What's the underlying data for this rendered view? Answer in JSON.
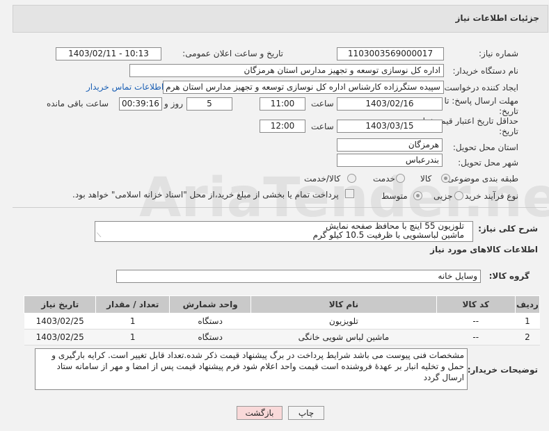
{
  "header": {
    "title": "جزئیات اطلاعات نیاز"
  },
  "watermark": "AriaTender.net",
  "fields": {
    "need_number_label": "شماره نیاز:",
    "need_number": "1103003569000017",
    "announce_label": "تاریخ و ساعت اعلان عمومی:",
    "announce_value": "1403/02/11 - 10:13",
    "buyer_label": "نام دستگاه خریدار:",
    "buyer_value": "اداره کل نوسازی  توسعه و تجهیز مدارس استان هرمزگان",
    "creator_label": "ایجاد کننده درخواست:",
    "creator_value": "سپیده ستگرزاده کارشناس اداره کل نوسازی  توسعه و تجهیز مدارس استان هرم",
    "contact_link": "اطلاعات تماس خریدار",
    "deadline_label_1": "مهلت ارسال پاسخ: تا",
    "deadline_label_2": "تاریخ:",
    "deadline_date": "1403/02/16",
    "time_label": "ساعت",
    "deadline_time": "11:00",
    "days_value": "5",
    "days_label": "روز و",
    "remaining_value": "00:39:16",
    "remaining_label": "ساعت باقی مانده",
    "validity_label_1": "حداقل تاریخ اعتبار قیمت: تا",
    "validity_label_2": "تاریخ:",
    "validity_date": "1403/03/15",
    "validity_time": "12:00",
    "province_label": "استان محل تحویل:",
    "province_value": "هرمزگان",
    "city_label": "شهر محل تحویل:",
    "city_value": "بندرعباس",
    "category_label": "طبقه بندی موضوعی:",
    "category_options": [
      "کالا",
      "خدمت",
      "کالا/خدمت"
    ],
    "process_label": "نوع فرآیند خرید :",
    "process_options": [
      "جزیی",
      "متوسط"
    ],
    "payment_note": "پرداخت تمام یا بخشی از مبلغ خرید،از محل \"اسناد خزانه اسلامی\" خواهد بود."
  },
  "description": {
    "label": "شرح کلی نیاز:",
    "lines": [
      "تلوزیون 55 اینچ با محافظ صفحه نمایش",
      "ماشین لباسشویی با ظرفیت 10.5 کیلو گرم"
    ]
  },
  "goods_section_title": "اطلاعات کالاهای مورد نیاز",
  "group_label": "گروه کالا:",
  "group_value": "وسایل خانه",
  "table": {
    "headers": [
      "ردیف",
      "کد کالا",
      "نام کالا",
      "واحد شمارش",
      "تعداد / مقدار",
      "تاریخ نیاز"
    ],
    "rows": [
      [
        "1",
        "--",
        "تلویزیون",
        "دستگاه",
        "1",
        "1403/02/25"
      ],
      [
        "2",
        "--",
        "ماشین لباس شویی خانگی",
        "دستگاه",
        "1",
        "1403/02/25"
      ]
    ]
  },
  "notes": {
    "label": "توضیحات خریدار:",
    "text": "مشخصات فنی پیوست می باشد شرایط پرداخت در برگ پیشنهاد قیمت ذکر شده.تعداد قابل تغییر است. کرایه بارگیری و حمل و تخلیه انبار بر عهدهٔ فروشنده است قیمت واحد اعلام شود  فرم پیشنهاد قیمت پس از امضا و مهر از سامانه ستاد ارسال گردد"
  },
  "buttons": {
    "print": "چاپ",
    "back": "بازگشت"
  }
}
